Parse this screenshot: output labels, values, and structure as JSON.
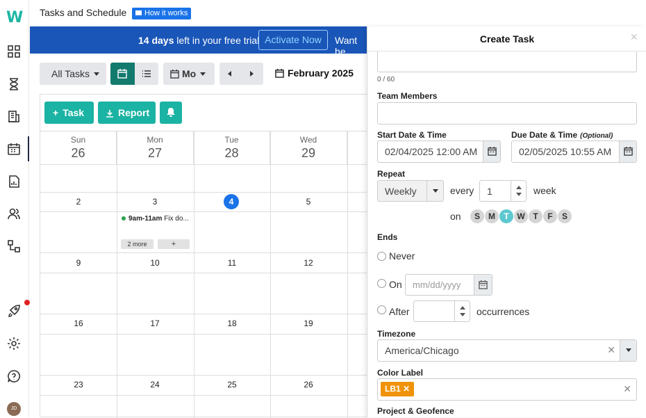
{
  "app": {
    "logo": "W",
    "title": "Tasks and Schedule",
    "how_it_works": "How it works",
    "avatar_initials": "JD"
  },
  "sidebar": {
    "items": [
      "dashboard-icon",
      "hourglass-icon",
      "building-icon",
      "calendar-icon",
      "report-icon",
      "users-icon",
      "workflow-icon",
      "rocket-icon",
      "gear-icon",
      "help-icon"
    ]
  },
  "banner": {
    "days": "14 days",
    "text": " left in your free trial",
    "cta": "Activate Now",
    "tail": "Want he"
  },
  "toolbar": {
    "filter": "All Tasks",
    "view_mode": "Mo",
    "month": "February 2025"
  },
  "actions": {
    "task": "Task",
    "report": "Report"
  },
  "calendar": {
    "header": [
      {
        "dow": "Sun",
        "day": "26"
      },
      {
        "dow": "Mon",
        "day": "27"
      },
      {
        "dow": "Tue",
        "day": "28"
      },
      {
        "dow": "Wed",
        "day": "29"
      }
    ],
    "weeks": [
      [
        "2",
        "3",
        "4",
        "5"
      ],
      [
        "9",
        "10",
        "11",
        "12"
      ],
      [
        "16",
        "17",
        "18",
        "19"
      ],
      [
        "23",
        "24",
        "25",
        "26"
      ]
    ],
    "event": {
      "time": "9am-11am",
      "title": "Fix do..."
    },
    "more": "2 more",
    "add": "+"
  },
  "panel": {
    "title": "Create Task",
    "close": "×",
    "counter": "0 / 60",
    "team_label": "Team Members",
    "start_label": "Start Date & Time",
    "start_value": "02/04/2025 12:00 AM",
    "due_label": "Due Date & Time",
    "due_optional": "(Optional)",
    "due_value": "02/05/2025 10:55 AM",
    "repeat_label": "Repeat",
    "repeat_value": "Weekly",
    "every": "every",
    "interval": "1",
    "unit": "week",
    "on": "on",
    "days": [
      "S",
      "M",
      "T",
      "W",
      "T",
      "F",
      "S"
    ],
    "ends_label": "Ends",
    "never": "Never",
    "on_label": "On",
    "on_placeholder": "mm/dd/yyyy",
    "after": "After",
    "occurrences": "occurrences",
    "tz_label": "Timezone",
    "tz_value": "America/Chicago",
    "color_label": "Color Label",
    "color_chip": "LB1",
    "project_label": "Project & Geofence"
  },
  "colors": {
    "accent": "#1bb3a3",
    "banner": "#1a56b8",
    "today": "#1a73e8",
    "chip": "#f0930a"
  }
}
